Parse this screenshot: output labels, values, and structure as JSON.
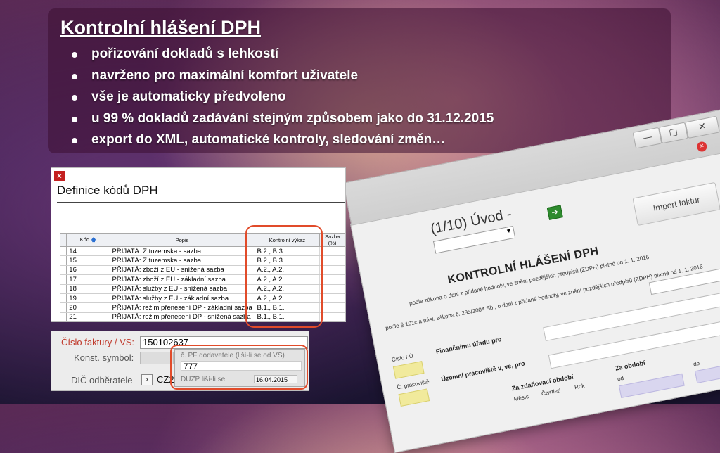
{
  "slide": {
    "title": "Kontrolní hlášení DPH",
    "bullets": [
      "pořizování dokladů s lehkostí",
      "navrženo pro maximální komfort uživatele",
      "vše je automaticky předvoleno",
      "u 99 % dokladů zadávání stejným způsobem jako do 31.12.2015",
      "export do XML, automatické kontroly, sledování změn…"
    ]
  },
  "kh_window": {
    "min_label": "—",
    "max_label": "▢",
    "close_label": "✕",
    "close_red": "×",
    "step": "(1/10) Úvod -",
    "step_dropdown": "▾",
    "next_button": "➔",
    "import_button": "Import faktur",
    "title": "KONTROLNÍ HLÁŠENÍ DPH",
    "subtitle": "podle zákona o dani z přidané hodnoty, ve znění pozdějších předpisů (ZDPH) platné od 1. 1. 2016",
    "law": "podle § 101c a násl. zákona č. 235/2004 Sb., o dani z přidané hodnoty, ve znění pozdějších předpisů (ZDPH) platné od 1. 1. 2016",
    "law_dropdown": "▾",
    "cislo_fu": "Číslo FÚ",
    "financnimu_uradu": "Finančnímu úřadu pro",
    "c_pracoviste": "Č. pracoviště",
    "uzemnimu": "Územní pracoviště v, ve, pro",
    "za_zdanovaci": "Za zdaňovací období",
    "za_obdobi": "Za období",
    "mesic": "Měsíc",
    "ctvrtleti": "Čtvrtletí",
    "rok": "Rok",
    "od": "od",
    "do": "do"
  },
  "definice": {
    "close_icon": "×",
    "title": "Definice kódů DPH",
    "columns": [
      "Kód",
      "Popis",
      "Kontrolní výkaz",
      "Sazba (%)"
    ],
    "sort_arrow": "🡅",
    "rows": [
      {
        "kod": "14",
        "popis": "PŘIJATÁ: Z tuzemska - sazba",
        "kv": "B.2., B.3."
      },
      {
        "kod": "15",
        "popis": "PŘIJATÁ: Z tuzemska - sazba",
        "kv": "B.2., B.3."
      },
      {
        "kod": "16",
        "popis": "PŘIJATÁ: zboží z EU - snížená sazba",
        "kv": "A.2., A.2."
      },
      {
        "kod": "17",
        "popis": "PŘIJATÁ: zboží z EU - základní sazba",
        "kv": "A.2., A.2."
      },
      {
        "kod": "18",
        "popis": "PŘIJATÁ: služby z EU - snížená sazba",
        "kv": "A.2., A.2."
      },
      {
        "kod": "19",
        "popis": "PŘIJATÁ: služby z EU - základní sazba",
        "kv": "A.2., A.2."
      },
      {
        "kod": "20",
        "popis": "PŘIJATÁ: režim přenesení DP - základní sazba",
        "kv": "B.1., B.1."
      },
      {
        "kod": "21",
        "popis": "PŘIJATÁ: režim přenesení DP - snížená sazba",
        "kv": "B.1., B.1."
      }
    ]
  },
  "faktura": {
    "cislo_label": "Číslo faktury / VS:",
    "cislo_value": "150102637",
    "konst_label": "Konst. symbol:",
    "dic_label": "DIČ odběratele",
    "dic_btn": "›",
    "dic_value": "CZ26",
    "popup_label": "č. PF dodavetele (liší-li se od VS)",
    "popup_value": "777",
    "duzp_label": "DUZP liší-li se:",
    "duzp_value": "16.04.2015"
  },
  "colors": {
    "highlight": "#e14b2a",
    "accent_red": "#c0392b"
  }
}
